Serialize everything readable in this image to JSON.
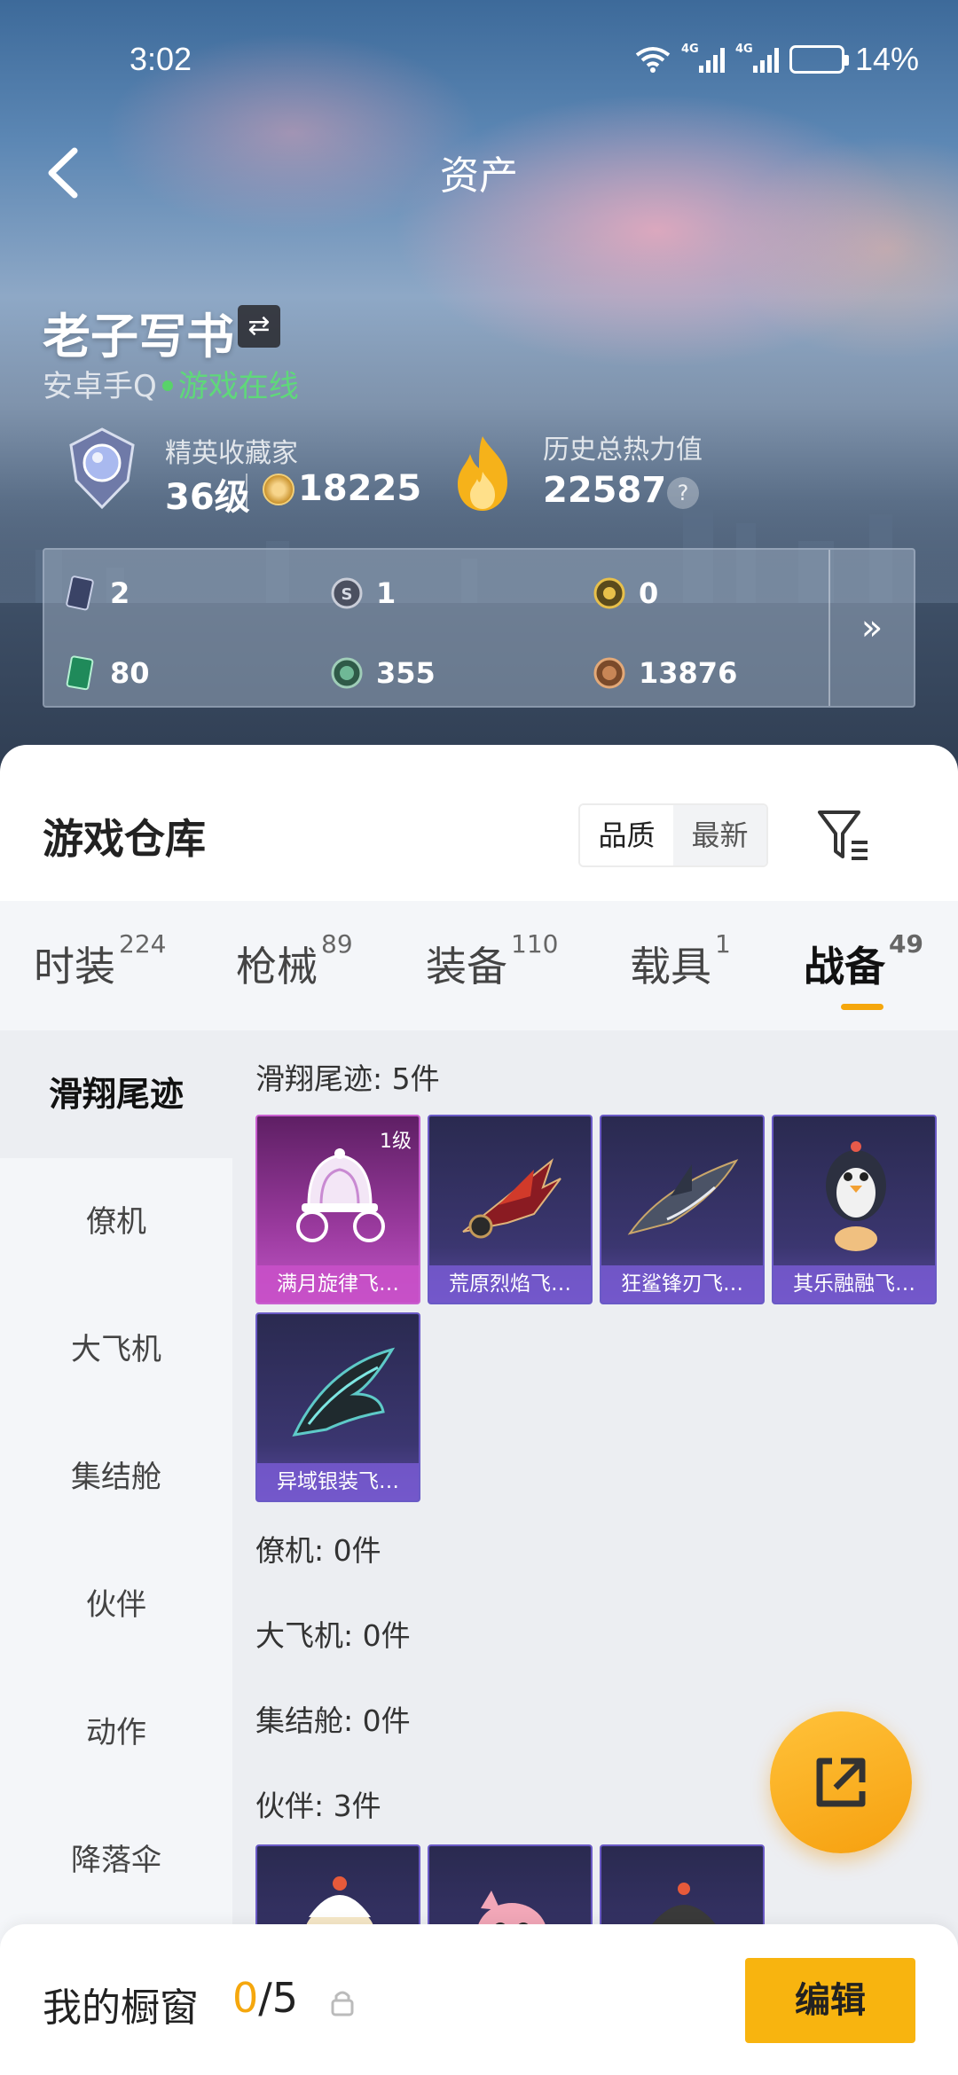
{
  "status": {
    "time": "3:02",
    "net1": "4G",
    "net2": "4G",
    "battery_percent": 14,
    "battery_text": "14%"
  },
  "header": {
    "title": "资产"
  },
  "profile": {
    "name": "老子写书",
    "platform": "安卓手Q",
    "online_status": "游戏在线",
    "collector_title": "精英收藏家",
    "level": "36级",
    "coins": "18225",
    "heat_label": "历史总热力值",
    "heat_value": "22587"
  },
  "currencies": [
    {
      "icon": "card-icon",
      "value": "2"
    },
    {
      "icon": "silver-coin-icon",
      "value": "1"
    },
    {
      "icon": "gold-coin-icon",
      "value": "0"
    },
    {
      "icon": "green-ticket-icon",
      "value": "80"
    },
    {
      "icon": "green-coin-icon",
      "value": "355"
    },
    {
      "icon": "bronze-coin-icon",
      "value": "13876"
    }
  ],
  "warehouse": {
    "title": "游戏仓库",
    "sort": [
      "品质",
      "最新"
    ],
    "tabs": [
      {
        "label": "时装",
        "count": "224"
      },
      {
        "label": "枪械",
        "count": "89"
      },
      {
        "label": "装备",
        "count": "110"
      },
      {
        "label": "载具",
        "count": "1"
      },
      {
        "label": "战备",
        "count": "49"
      }
    ],
    "subnav": [
      "滑翔尾迹",
      "僚机",
      "大飞机",
      "集结舱",
      "伙伴",
      "动作",
      "降落伞"
    ],
    "groups": {
      "glide": {
        "label": "滑翔尾迹: 5件"
      },
      "wingman": {
        "label": "僚机: 0件"
      },
      "plane": {
        "label": "大飞机: 0件"
      },
      "pod": {
        "label": "集结舱: 0件"
      },
      "partner": {
        "label": "伙伴: 3件"
      }
    },
    "glide_items": [
      {
        "name": "满月旋律飞…",
        "level": "1级"
      },
      {
        "name": "荒原烈焰飞…"
      },
      {
        "name": "狂鲨锋刃飞…"
      },
      {
        "name": "其乐融融飞…"
      },
      {
        "name": "异域银装飞…"
      }
    ]
  },
  "showcase": {
    "label": "我的橱窗",
    "current": "0",
    "total": "/5",
    "edit": "编辑"
  },
  "colors": {
    "accent": "#f5a70d",
    "online": "#5fd87a"
  }
}
